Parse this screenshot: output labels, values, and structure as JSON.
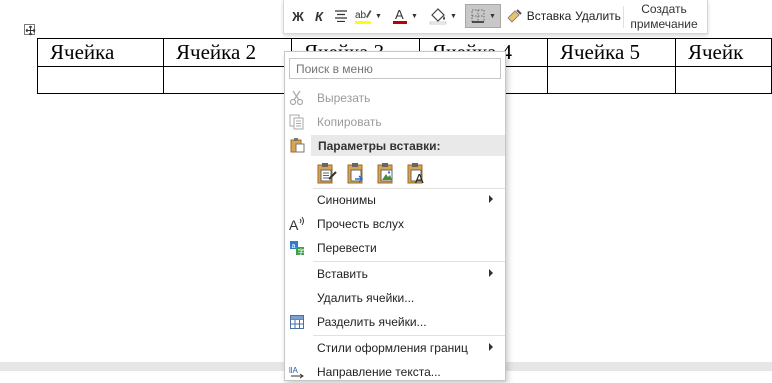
{
  "table": {
    "row1": [
      "Ячейка",
      "Ячейка 2",
      "Ячейка 3",
      "Ячейка 4",
      "Ячейка 5",
      "Ячейк"
    ],
    "row2": [
      "",
      "",
      "",
      "",
      "",
      ""
    ]
  },
  "toolbar": {
    "bold": "Ж",
    "italic": "К",
    "insert": "Вставка",
    "delete": "Удалить",
    "create_comment_line1": "Создать",
    "create_comment_line2": "примечание"
  },
  "menu": {
    "search_placeholder": "Поиск в меню",
    "cut": "Вырезать",
    "copy": "Копировать",
    "paste_options": "Параметры вставки:",
    "synonyms": "Синонимы",
    "read_aloud": "Прочесть вслух",
    "translate": "Перевести",
    "insert": "Вставить",
    "delete_cells": "Удалить ячейки...",
    "split_cells": "Разделить ячейки...",
    "border_styles": "Стили оформления границ",
    "text_direction": "Направление текста..."
  },
  "colors": {
    "font_color": "#c00000",
    "highlight": "#ffff00",
    "selected_button": "#c8c8c8"
  }
}
